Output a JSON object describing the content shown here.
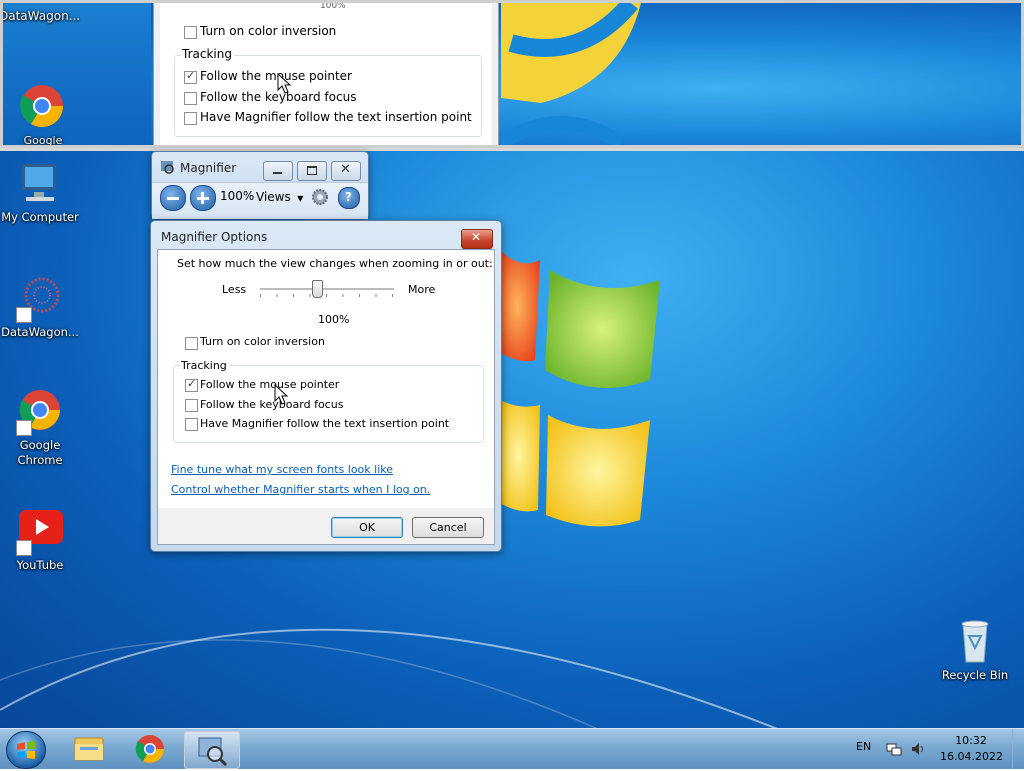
{
  "desktop": {
    "icons": [
      {
        "label": "My Computer"
      },
      {
        "label": "DataWagon..."
      },
      {
        "label": "Google Chrome"
      },
      {
        "label": "YouTube"
      },
      {
        "label": "Recycle Bin"
      }
    ]
  },
  "magnified": {
    "icon_label": "DataWagon...",
    "chrome_label": "Google",
    "top_text": "100%",
    "color_inversion": "Turn on color inversion",
    "tracking": "Tracking",
    "follow_mouse": "Follow the mouse pointer",
    "follow_keyboard": "Follow the keyboard focus",
    "follow_text": "Have Magnifier follow the text insertion point"
  },
  "magnifier": {
    "title": "Magnifier",
    "zoom": "100%",
    "views": "Views"
  },
  "options": {
    "title": "Magnifier Options",
    "zoom_prompt": "Set how much the view changes when zooming in or out:",
    "less": "Less",
    "more": "More",
    "slider_fraction": 0.42,
    "slider_value": "100%",
    "color_inversion": "Turn on color inversion",
    "color_inversion_checked": false,
    "tracking": "Tracking",
    "follow_mouse": "Follow the mouse pointer",
    "follow_mouse_checked": true,
    "follow_keyboard": "Follow the keyboard focus",
    "follow_keyboard_checked": false,
    "follow_text": "Have Magnifier follow the text insertion point",
    "follow_text_checked": false,
    "link1": "Fine tune what my screen fonts look like",
    "link2": "Control whether Magnifier starts when I log on.",
    "ok": "OK",
    "cancel": "Cancel"
  },
  "taskbar": {
    "language": "EN",
    "time": "10:32",
    "date": "16.04.2022"
  }
}
